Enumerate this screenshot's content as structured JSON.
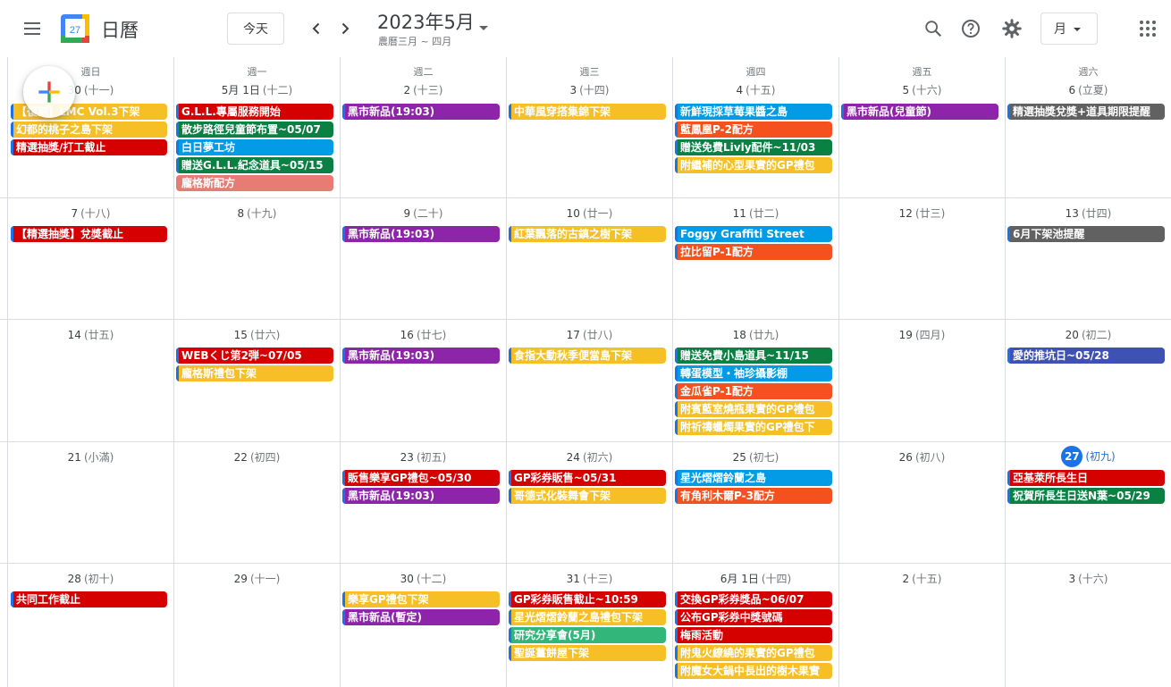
{
  "app": {
    "title": "日曆",
    "logo_day": "27"
  },
  "toolbar": {
    "today_label": "今天",
    "month_title": "2023年5月",
    "lunar_subtitle": "農曆三月 ~ 四月",
    "view_label": "月"
  },
  "icons": {
    "menu": "hamburger-menu-icon",
    "prev": "chevron-left-icon",
    "next": "chevron-right-icon",
    "search": "search-icon",
    "help": "help-icon",
    "settings": "gear-icon",
    "apps": "apps-grid-icon",
    "create": "plus-icon"
  },
  "weekdays": [
    "週日",
    "週一",
    "週二",
    "週三",
    "週四",
    "週五",
    "週六"
  ],
  "colors": {
    "yellow": "#f6bf26",
    "red": "#d50000",
    "green": "#0b8043",
    "blue": "#039be5",
    "purple": "#8e24aa",
    "tomato": "#f4511e",
    "flamingo": "#e67c73",
    "grey": "#616161",
    "lavender": "#3f51b5",
    "basil": "#33b679",
    "today": "#1a73e8"
  },
  "weeks": [
    [
      {
        "num": "30",
        "lunar": "(十一)",
        "events": [
          {
            "t": "【復刻】LMC Vol.3下架",
            "c": "yellow"
          },
          {
            "t": "幻都的桃子之島下架",
            "c": "yellow"
          },
          {
            "t": "精選抽獎/打工截止",
            "c": "red"
          }
        ]
      },
      {
        "num": "5月 1日",
        "lunar": "(十二)",
        "events": [
          {
            "t": "G.L.L.專屬服務開始",
            "c": "red"
          },
          {
            "t": "散步路徑兒童節布置~05/07",
            "c": "green"
          },
          {
            "t": "白日夢工坊",
            "c": "blue"
          },
          {
            "t": "贈送G.L.L.紀念道具~05/15",
            "c": "green"
          },
          {
            "t": "龐格斯配方",
            "c": "flamingo"
          }
        ]
      },
      {
        "num": "2",
        "lunar": "(十三)",
        "events": [
          {
            "t": "黑市新品(19:03)",
            "c": "purple"
          }
        ]
      },
      {
        "num": "3",
        "lunar": "(十四)",
        "events": [
          {
            "t": "中華風穿搭集錦下架",
            "c": "yellow"
          }
        ]
      },
      {
        "num": "4",
        "lunar": "(十五)",
        "events": [
          {
            "t": "新鮮現採草莓果醬之島",
            "c": "blue"
          },
          {
            "t": "藍鳳凰P-2配方",
            "c": "tomato"
          },
          {
            "t": "贈送免費Livly配件~11/03",
            "c": "green"
          },
          {
            "t": "附繼補的心型果實的GP禮包",
            "c": "yellow"
          }
        ]
      },
      {
        "num": "5",
        "lunar": "(十六)",
        "events": [
          {
            "t": "黑市新品(兒童節)",
            "c": "purple"
          }
        ]
      },
      {
        "num": "6",
        "lunar": "(立夏)",
        "events": [
          {
            "t": "精選抽獎兌獎+道具期限提醒",
            "c": "grey"
          }
        ]
      }
    ],
    [
      {
        "num": "7",
        "lunar": "(十八)",
        "events": [
          {
            "t": "【精選抽獎】兌獎截止",
            "c": "red"
          }
        ]
      },
      {
        "num": "8",
        "lunar": "(十九)",
        "events": []
      },
      {
        "num": "9",
        "lunar": "(二十)",
        "events": [
          {
            "t": "黑市新品(19:03)",
            "c": "purple"
          }
        ]
      },
      {
        "num": "10",
        "lunar": "(廿一)",
        "events": [
          {
            "t": "紅葉飄落的古鎮之樹下架",
            "c": "yellow"
          }
        ]
      },
      {
        "num": "11",
        "lunar": "(廿二)",
        "events": [
          {
            "t": "Foggy Graffiti Street",
            "c": "blue"
          },
          {
            "t": "拉比留P-1配方",
            "c": "tomato"
          }
        ]
      },
      {
        "num": "12",
        "lunar": "(廿三)",
        "events": []
      },
      {
        "num": "13",
        "lunar": "(廿四)",
        "events": [
          {
            "t": "6月下架池提醒",
            "c": "grey"
          }
        ]
      }
    ],
    [
      {
        "num": "14",
        "lunar": "(廿五)",
        "events": []
      },
      {
        "num": "15",
        "lunar": "(廿六)",
        "events": [
          {
            "t": "WEBくじ第2弾~07/05",
            "c": "red"
          },
          {
            "t": "龐格斯禮包下架",
            "c": "yellow"
          }
        ]
      },
      {
        "num": "16",
        "lunar": "(廿七)",
        "events": [
          {
            "t": "黑市新品(19:03)",
            "c": "purple"
          }
        ]
      },
      {
        "num": "17",
        "lunar": "(廿八)",
        "events": [
          {
            "t": "食指大動秋季便當島下架",
            "c": "yellow"
          }
        ]
      },
      {
        "num": "18",
        "lunar": "(廿九)",
        "events": [
          {
            "t": "贈送免費小島道具~11/15",
            "c": "green"
          },
          {
            "t": "轉蛋模型・袖珍攝影棚",
            "c": "blue"
          },
          {
            "t": "金瓜雀P-1配方",
            "c": "tomato"
          },
          {
            "t": "附賓藍室燒瓶果實的GP禮包",
            "c": "yellow"
          },
          {
            "t": "附祈禱蠟燭果實的GP禮包下",
            "c": "yellow"
          }
        ]
      },
      {
        "num": "19",
        "lunar": "(四月)",
        "events": []
      },
      {
        "num": "20",
        "lunar": "(初二)",
        "events": [
          {
            "t": "愛的推坑日~05/28",
            "c": "lavender"
          }
        ]
      }
    ],
    [
      {
        "num": "21",
        "lunar": "(小滿)",
        "events": []
      },
      {
        "num": "22",
        "lunar": "(初四)",
        "events": []
      },
      {
        "num": "23",
        "lunar": "(初五)",
        "events": [
          {
            "t": "販售樂享GP禮包~05/30",
            "c": "red"
          },
          {
            "t": "黑市新品(19:03)",
            "c": "purple"
          }
        ]
      },
      {
        "num": "24",
        "lunar": "(初六)",
        "events": [
          {
            "t": "GP彩券販售~05/31",
            "c": "red"
          },
          {
            "t": "哥德式化裝舞會下架",
            "c": "yellow"
          }
        ]
      },
      {
        "num": "25",
        "lunar": "(初七)",
        "events": [
          {
            "t": "星光熠熠鈴蘭之島",
            "c": "blue"
          },
          {
            "t": "有角利木爾P-3配方",
            "c": "tomato"
          }
        ]
      },
      {
        "num": "26",
        "lunar": "(初八)",
        "events": []
      },
      {
        "num": "27",
        "lunar": "(初九)",
        "today": true,
        "events": [
          {
            "t": "亞基萊所長生日",
            "c": "red"
          },
          {
            "t": "祝賀所長生日送N葉~05/29",
            "c": "green"
          }
        ]
      }
    ],
    [
      {
        "num": "28",
        "lunar": "(初十)",
        "events": [
          {
            "t": "共同工作截止",
            "c": "red"
          }
        ]
      },
      {
        "num": "29",
        "lunar": "(十一)",
        "events": []
      },
      {
        "num": "30",
        "lunar": "(十二)",
        "events": [
          {
            "t": "樂享GP禮包下架",
            "c": "yellow"
          },
          {
            "t": "黑市新品(暫定)",
            "c": "purple"
          }
        ]
      },
      {
        "num": "31",
        "lunar": "(十三)",
        "events": [
          {
            "t": "GP彩券販售截止~10:59",
            "c": "red"
          },
          {
            "t": "星光熠熠鈴蘭之島禮包下架",
            "c": "yellow"
          },
          {
            "t": "研究分享會(5月)",
            "c": "basil"
          },
          {
            "t": "聖誕薑餅屋下架",
            "c": "yellow"
          }
        ]
      },
      {
        "num": "6月 1日",
        "lunar": "(十四)",
        "events": [
          {
            "t": "交換GP彩券獎品~06/07",
            "c": "red"
          },
          {
            "t": "公布GP彩券中獎號碼",
            "c": "red"
          },
          {
            "t": "梅雨活動",
            "c": "red"
          },
          {
            "t": "附鬼火繚繞的果實的GP禮包",
            "c": "yellow"
          },
          {
            "t": "附魔女大鍋中長出的樹木果實",
            "c": "yellow"
          }
        ]
      },
      {
        "num": "2",
        "lunar": "(十五)",
        "events": []
      },
      {
        "num": "3",
        "lunar": "(十六)",
        "events": []
      }
    ]
  ]
}
